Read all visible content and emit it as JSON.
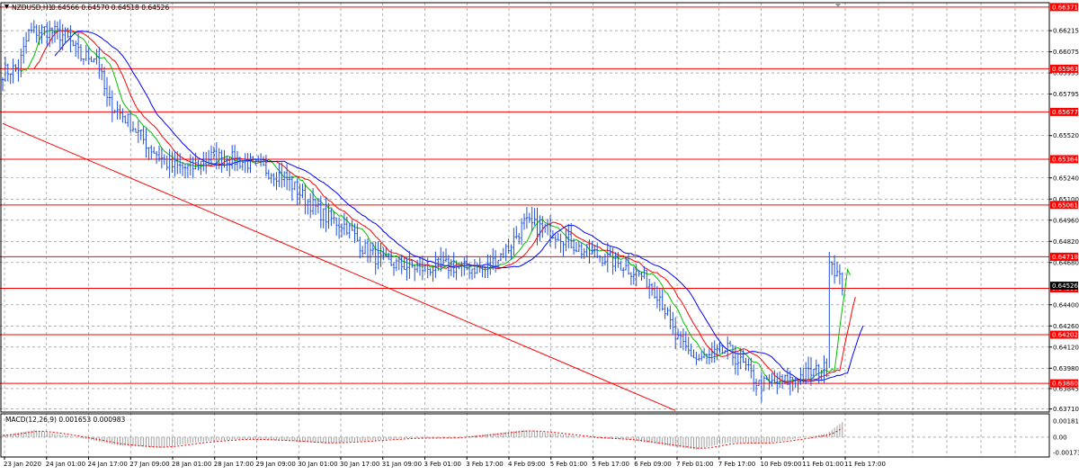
{
  "header": {
    "symbol": "NZDUSD,H1",
    "ohlc": "0.64566 0.64570 0.64518 0.64526"
  },
  "colors": {
    "background": "#ffffff",
    "grid": "#7f7f7f",
    "price_bar": "#1f4fd8",
    "level_line": "#ff0000",
    "trendline": "#ff0000",
    "ma_fast": "#00c000",
    "ma_mid": "#ff0000",
    "ma_slow": "#0000ff",
    "macd_hist": "#a0a0a0",
    "macd_signal": "#ff0000",
    "level_tag_bg": "#ff0000",
    "level_tag_text": "#ffffff"
  },
  "chart_data": [
    {
      "type": "candlestick",
      "symbol": "NZDUSD",
      "timeframe": "H1",
      "ylim": [
        0.6369,
        0.664
      ],
      "grid": true,
      "x_ticks": [
        "23 Jan 2020",
        "24 Jan 01:00",
        "24 Jan 17:00",
        "27 Jan 09:00",
        "28 Jan 01:00",
        "28 Jan 17:00",
        "29 Jan 09:00",
        "30 Jan 01:00",
        "30 Jan 17:00",
        "31 Jan 09:00",
        "3 Feb 01:00",
        "3 Feb 17:00",
        "4 Feb 09:00",
        "5 Feb 01:00",
        "5 Feb 17:00",
        "6 Feb 09:00",
        "7 Feb 01:00",
        "7 Feb 17:00",
        "10 Feb 09:00",
        "11 Feb 01:00",
        "11 Feb 17:00"
      ],
      "y_ticks": [
        "0.66215",
        "0.66075",
        "0.65935",
        "0.65795",
        "0.65520",
        "0.65240",
        "0.65100",
        "0.64960",
        "0.64820",
        "0.64680",
        "0.64400",
        "0.64260",
        "0.64120",
        "0.63980",
        "0.63845",
        "0.63710"
      ],
      "levels": [
        {
          "value": 0.66371,
          "label": "0.66371"
        },
        {
          "value": 0.65963,
          "label": "0.65963"
        },
        {
          "value": 0.65677,
          "label": "0.65677"
        },
        {
          "value": 0.65364,
          "label": "0.65364"
        },
        {
          "value": 0.65061,
          "label": "0.65061"
        },
        {
          "value": 0.64718,
          "label": "0.64718"
        },
        {
          "value": 0.64509,
          "label": "0.64509"
        },
        {
          "value": 0.64202,
          "label": "0.64202"
        },
        {
          "value": 0.6388,
          "label": "0.63880"
        }
      ],
      "current_price": {
        "value": 0.64526,
        "label": "0.64526"
      },
      "trendline": {
        "from": {
          "bar": 0,
          "value": 0.656
        },
        "to": {
          "bar": 258,
          "value": 0.637
        }
      },
      "anchors": [
        {
          "bar": 0,
          "value": 0.6594
        },
        {
          "bar": 6,
          "value": 0.6597
        },
        {
          "bar": 10,
          "value": 0.662
        },
        {
          "bar": 16,
          "value": 0.6622
        },
        {
          "bar": 24,
          "value": 0.6618
        },
        {
          "bar": 30,
          "value": 0.6604
        },
        {
          "bar": 36,
          "value": 0.6605
        },
        {
          "bar": 40,
          "value": 0.6575
        },
        {
          "bar": 48,
          "value": 0.6562
        },
        {
          "bar": 56,
          "value": 0.6545
        },
        {
          "bar": 64,
          "value": 0.6532
        },
        {
          "bar": 72,
          "value": 0.653
        },
        {
          "bar": 80,
          "value": 0.6538
        },
        {
          "bar": 86,
          "value": 0.6537
        },
        {
          "bar": 94,
          "value": 0.6534
        },
        {
          "bar": 100,
          "value": 0.653
        },
        {
          "bar": 108,
          "value": 0.6525
        },
        {
          "bar": 116,
          "value": 0.651
        },
        {
          "bar": 124,
          "value": 0.6498
        },
        {
          "bar": 132,
          "value": 0.6492
        },
        {
          "bar": 138,
          "value": 0.6478
        },
        {
          "bar": 146,
          "value": 0.6468
        },
        {
          "bar": 154,
          "value": 0.6466
        },
        {
          "bar": 162,
          "value": 0.6464
        },
        {
          "bar": 170,
          "value": 0.6466
        },
        {
          "bar": 178,
          "value": 0.6464
        },
        {
          "bar": 186,
          "value": 0.6465
        },
        {
          "bar": 194,
          "value": 0.6478
        },
        {
          "bar": 200,
          "value": 0.6494
        },
        {
          "bar": 208,
          "value": 0.649
        },
        {
          "bar": 214,
          "value": 0.6486
        },
        {
          "bar": 222,
          "value": 0.6476
        },
        {
          "bar": 230,
          "value": 0.6472
        },
        {
          "bar": 238,
          "value": 0.6466
        },
        {
          "bar": 246,
          "value": 0.6458
        },
        {
          "bar": 252,
          "value": 0.6446
        },
        {
          "bar": 258,
          "value": 0.6418
        },
        {
          "bar": 266,
          "value": 0.6404
        },
        {
          "bar": 272,
          "value": 0.6406
        },
        {
          "bar": 278,
          "value": 0.641
        },
        {
          "bar": 284,
          "value": 0.64
        },
        {
          "bar": 290,
          "value": 0.6387
        },
        {
          "bar": 296,
          "value": 0.6388
        },
        {
          "bar": 302,
          "value": 0.639
        },
        {
          "bar": 308,
          "value": 0.6394
        },
        {
          "bar": 312,
          "value": 0.6396
        },
        {
          "bar": 316,
          "value": 0.6398
        },
        {
          "bar": 317,
          "value": 0.6472
        },
        {
          "bar": 320,
          "value": 0.646
        },
        {
          "bar": 322,
          "value": 0.6453
        }
      ]
    },
    {
      "type": "bar",
      "title": "MACD(12,26,9) 0.001653 0.000983",
      "ylim": [
        -0.00173,
        0.00181
      ],
      "y_ticks": [
        "0.001814",
        "0.00",
        "-0.001732"
      ],
      "macd_anchors": [
        {
          "bar": 0,
          "value": 0.0002
        },
        {
          "bar": 12,
          "value": 0.0008
        },
        {
          "bar": 28,
          "value": 0.0
        },
        {
          "bar": 44,
          "value": -0.0009
        },
        {
          "bar": 60,
          "value": -0.0012
        },
        {
          "bar": 76,
          "value": -0.0005
        },
        {
          "bar": 92,
          "value": -0.0002
        },
        {
          "bar": 108,
          "value": -0.0004
        },
        {
          "bar": 124,
          "value": -0.0007
        },
        {
          "bar": 140,
          "value": -0.0004
        },
        {
          "bar": 156,
          "value": -0.0001
        },
        {
          "bar": 172,
          "value": -0.0001
        },
        {
          "bar": 188,
          "value": 0.0004
        },
        {
          "bar": 200,
          "value": 0.0008
        },
        {
          "bar": 212,
          "value": 0.0004
        },
        {
          "bar": 226,
          "value": -0.0001
        },
        {
          "bar": 240,
          "value": -0.0003
        },
        {
          "bar": 256,
          "value": -0.001
        },
        {
          "bar": 266,
          "value": -0.0014
        },
        {
          "bar": 278,
          "value": -0.0006
        },
        {
          "bar": 292,
          "value": -0.0007
        },
        {
          "bar": 306,
          "value": -0.0001
        },
        {
          "bar": 316,
          "value": 0.0004
        },
        {
          "bar": 322,
          "value": 0.0017
        }
      ]
    }
  ]
}
